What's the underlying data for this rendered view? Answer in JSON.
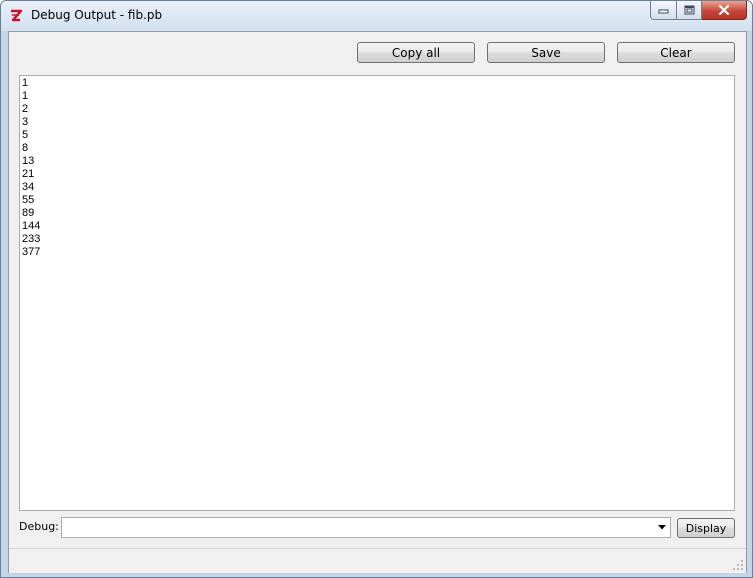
{
  "window": {
    "title": "Debug Output - fib.pb",
    "icon": "purebasic-app-icon",
    "caption_buttons": [
      "minimize-icon",
      "maximize-icon",
      "close-icon"
    ]
  },
  "toolbar": {
    "copy_all_label": "Copy all",
    "save_label": "Save",
    "clear_label": "Clear"
  },
  "output": {
    "lines": [
      "1",
      "1",
      "2",
      "3",
      "5",
      "8",
      "13",
      "21",
      "34",
      "55",
      "89",
      "144",
      "233",
      "377"
    ]
  },
  "debug": {
    "label": "Debug:",
    "value": "",
    "display_label": "Display"
  },
  "colors": {
    "title_bar": "#d3e0ee",
    "close_button": "#c9483a",
    "client_background": "#f0f0f0",
    "output_background": "#ffffff"
  }
}
